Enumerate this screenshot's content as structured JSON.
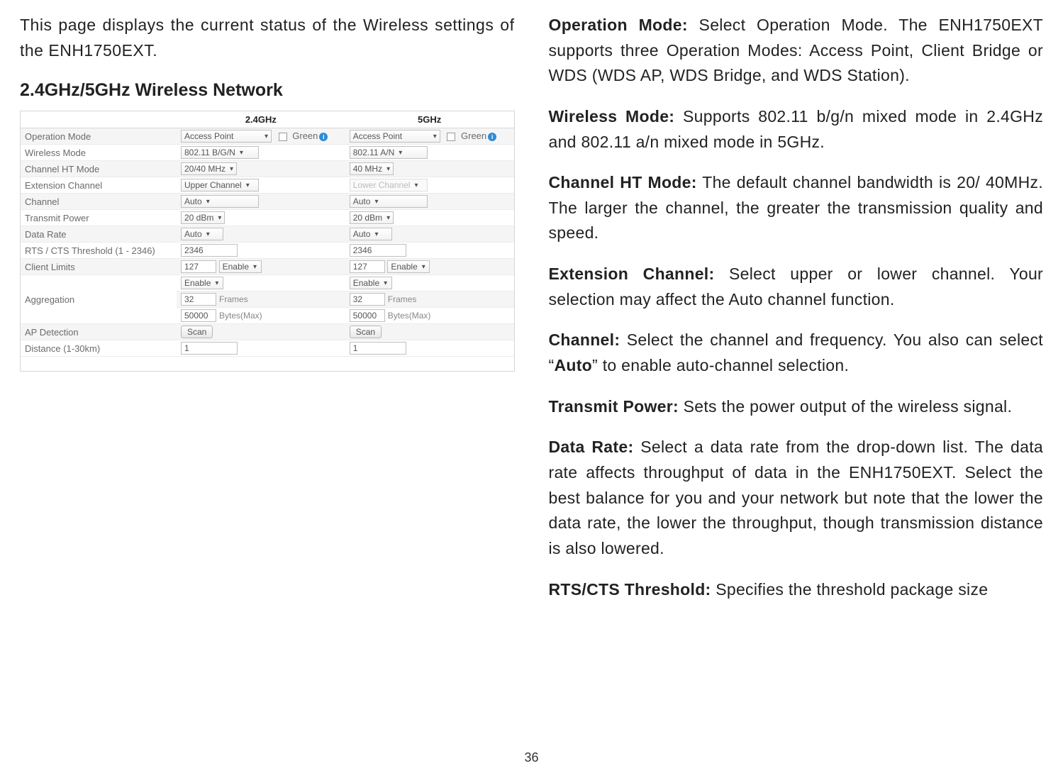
{
  "page_number": "36",
  "left": {
    "intro": "This page displays the current status of the Wireless settings of the ENH1750EXT.",
    "heading": "2.4GHz/5GHz Wireless Network"
  },
  "table": {
    "cols": {
      "band24": "2.4GHz",
      "band5": "5GHz"
    },
    "green": "Green",
    "rows": {
      "operation_mode": {
        "label": "Operation Mode",
        "v24": "Access Point",
        "v5": "Access Point"
      },
      "wireless_mode": {
        "label": "Wireless Mode",
        "v24": "802.11 B/G/N",
        "v5": "802.11 A/N"
      },
      "ht_mode": {
        "label": "Channel HT Mode",
        "v24": "20/40 MHz",
        "v5": "40 MHz"
      },
      "ext_channel": {
        "label": "Extension Channel",
        "v24": "Upper Channel",
        "v5": "Lower Channel"
      },
      "channel": {
        "label": "Channel",
        "v24": "Auto",
        "v5": "Auto"
      },
      "tx_power": {
        "label": "Transmit Power",
        "v24": "20 dBm",
        "v5": "20 dBm"
      },
      "data_rate": {
        "label": "Data Rate",
        "v24": "Auto",
        "v5": "Auto"
      },
      "rts": {
        "label": "RTS / CTS Threshold (1 - 2346)",
        "v24": "2346",
        "v5": "2346"
      },
      "client_limits": {
        "label": "Client Limits",
        "v24": "127",
        "v5": "127",
        "enable": "Enable"
      },
      "aggregation": {
        "label": "Aggregation",
        "enable": "Enable",
        "frames24": "32",
        "frames5": "32",
        "frames_unit": "Frames",
        "bytes24": "50000",
        "bytes5": "50000",
        "bytes_unit": "Bytes(Max)"
      },
      "ap_detection": {
        "label": "AP Detection",
        "btn": "Scan"
      },
      "distance": {
        "label": "Distance (1-30km)",
        "v24": "1",
        "v5": "1"
      }
    }
  },
  "right": {
    "op_mode": {
      "lead": "Operation Mode:",
      "text": " Select Operation Mode. The ENH1750EXT supports three Operation Modes: Access Point, Client Bridge or WDS (WDS AP, WDS Bridge, and WDS Station)."
    },
    "wireless_mode": {
      "lead": "Wireless Mode:",
      "text": " Supports 802.11 b/g/n mixed mode in 2.4GHz and 802.11 a/n mixed mode in 5GHz."
    },
    "ht_mode": {
      "lead": "Channel HT Mode:",
      "text": " The default channel bandwidth is 20/ 40MHz. The larger the channel, the greater the transmission quality and speed."
    },
    "ext_channel": {
      "lead": "Extension Channel:",
      "text": " Select upper or lower channel. Your selection may affect the Auto channel function."
    },
    "channel": {
      "lead": "Channel:",
      "pre": " Select the channel and frequency. You also can select “",
      "bold": "Auto",
      "post": "” to enable auto-channel selection."
    },
    "tx_power": {
      "lead": "Transmit Power:",
      "text": " Sets the power output of the wireless signal."
    },
    "data_rate": {
      "lead": "Data Rate:",
      "text": " Select a data rate from the drop-down list. The data rate affects throughput of data in the ENH1750EXT. Select the best balance for you and your network but note that the lower the data rate, the lower the throughput, though transmission distance is also lowered."
    },
    "rts": {
      "lead": "RTS/CTS Threshold:",
      "text": " Specifies the threshold package size"
    }
  }
}
